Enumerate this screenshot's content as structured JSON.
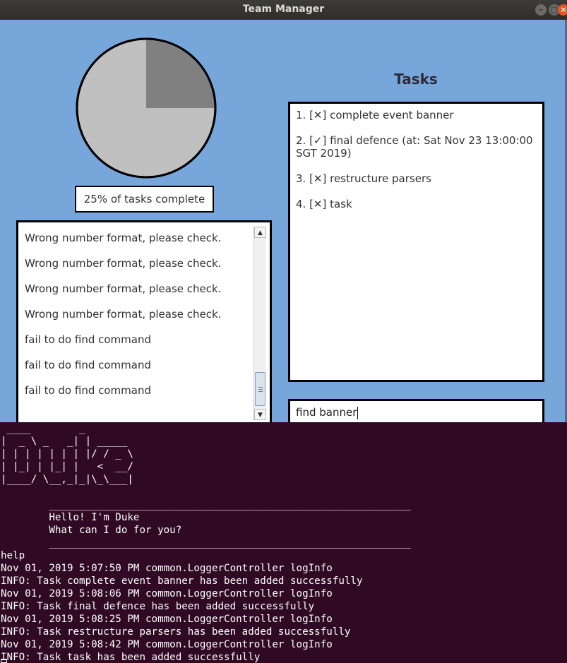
{
  "window": {
    "title": "Team Manager"
  },
  "pie": {
    "complete_fraction": 0.25,
    "complete_color": "#808080",
    "remaining_color": "#c0c0c0"
  },
  "progress_label": "25% of tasks complete",
  "log": {
    "lines": [
      "Wrong number format, please check.",
      "Wrong number format, please check.",
      "Wrong number format, please check.",
      "Wrong number format, please check.",
      "fail to do find command",
      "fail to do find command",
      "fail to do find command"
    ]
  },
  "tasks_panel": {
    "title": "Tasks",
    "items": [
      {
        "line1": "1. [✕] complete event banner",
        "line2": ""
      },
      {
        "line1": "2. [✓] final defence (at: Sat Nov 23 13:00:00",
        "line2": "SGT 2019)"
      },
      {
        "line1": "3. [✕] restructure parsers",
        "line2": ""
      },
      {
        "line1": "4. [✕] task",
        "line2": ""
      }
    ]
  },
  "command_input": {
    "value": "find banner"
  },
  "terminal": {
    "lines": [
      " ____        _",
      "|  _ \\ _   _| | _____",
      "| | | | | | | |/ / _ \\",
      "| |_| | |_| |   <  __/",
      "|____/ \\__,_|_|\\_\\___|",
      "",
      "        ____________________________________________________________",
      "        Hello! I'm Duke",
      "        What can I do for you?",
      "        ____________________________________________________________",
      "help",
      "Nov 01, 2019 5:07:50 PM common.LoggerController logInfo",
      "INFO: Task complete event banner has been added successfully",
      "Nov 01, 2019 5:08:06 PM common.LoggerController logInfo",
      "INFO: Task final defence has been added successfully",
      "Nov 01, 2019 5:08:25 PM common.LoggerController logInfo",
      "INFO: Task restructure parsers has been added successfully",
      "Nov 01, 2019 5:08:42 PM common.LoggerController logInfo",
      "INFO: Task task has been added successfully"
    ]
  }
}
